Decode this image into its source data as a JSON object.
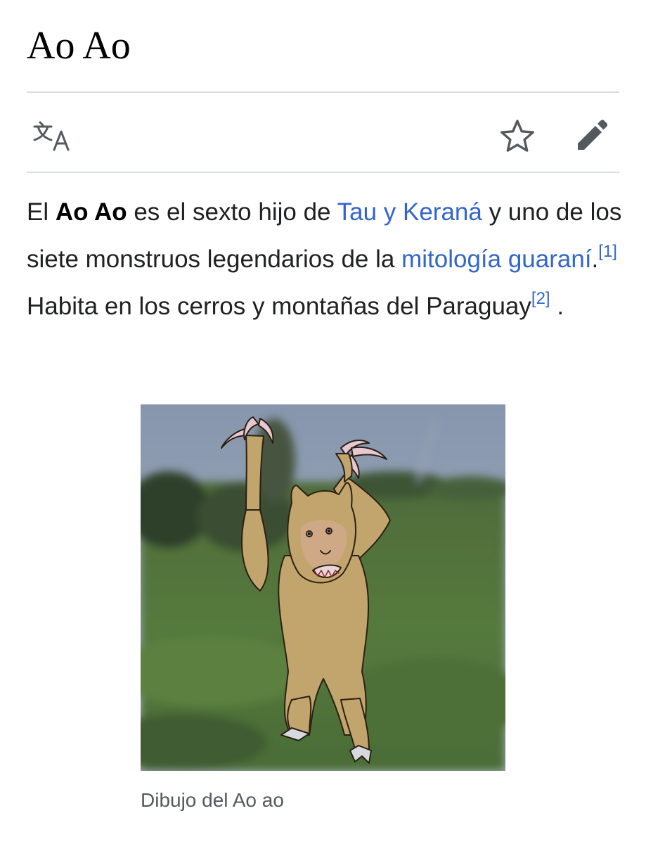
{
  "page": {
    "title": "Ao Ao"
  },
  "toolbar": {
    "language_icon": "translate-icon",
    "watch_icon": "star-icon",
    "edit_icon": "pencil-icon"
  },
  "article": {
    "p1_before_bold": "El ",
    "p1_bold": "Ao Ao",
    "p1_after_bold": " es el sexto hijo de ",
    "link_tau": "Tau y Keraná",
    "p1_after_link": " y uno de los siete monstruos legendarios de la ",
    "link_mitologia": "mitología guaraní",
    "p1_period": ".",
    "ref1": "[1]",
    "p1_habita": "  Habita en los cerros y montañas del Paraguay",
    "ref2": "[2]",
    "p1_end": " ."
  },
  "figure": {
    "caption": "Dibujo del Ao ao"
  },
  "colors": {
    "link": "#3366cc",
    "text": "#202122",
    "caption": "#54595d",
    "divider": "#dadde3",
    "icon": "#54595d"
  }
}
